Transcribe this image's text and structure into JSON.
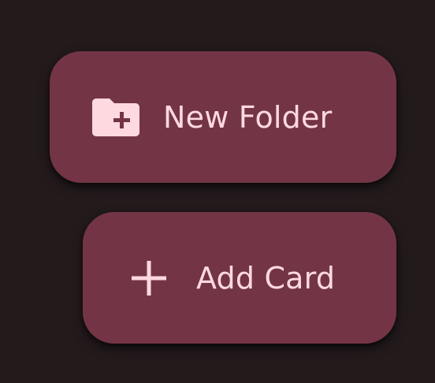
{
  "theme": {
    "background": "#231a1c",
    "button_background": "#733545",
    "button_foreground": "#ffd9e0"
  },
  "actions": [
    {
      "label": "New Folder",
      "icon": "create-new-folder-icon"
    },
    {
      "label": "Add Card",
      "icon": "add-icon"
    }
  ]
}
